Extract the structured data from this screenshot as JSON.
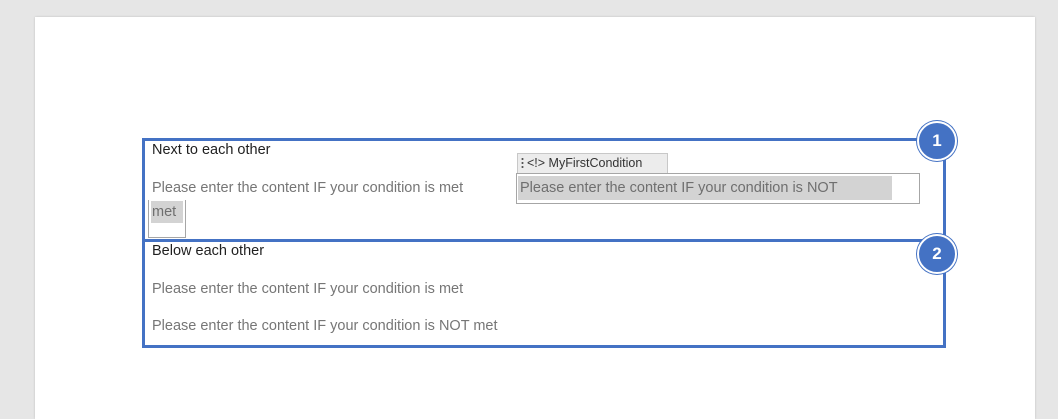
{
  "document": {
    "section1": {
      "heading": "Next to each other",
      "met_text": "Please enter the content IF your condition is met",
      "condition_tag": "<!> MyFirstCondition",
      "not_met_text": "Please enter the content IF your condition is NOT",
      "not_met_wrap": "met"
    },
    "section2": {
      "heading": "Below each other",
      "met_text": "Please enter the content IF your condition is met",
      "not_met_text": "Please enter the content IF your condition is NOT met"
    }
  },
  "callouts": [
    {
      "number": "1"
    },
    {
      "number": "2"
    }
  ],
  "colors": {
    "callout_accent": "#4472c4",
    "page_background": "#ffffff",
    "workspace_background": "#e6e6e6",
    "content_control_highlight": "#d3d3d3"
  },
  "icons": {
    "content_control_handle": "drag-grip-icon"
  }
}
